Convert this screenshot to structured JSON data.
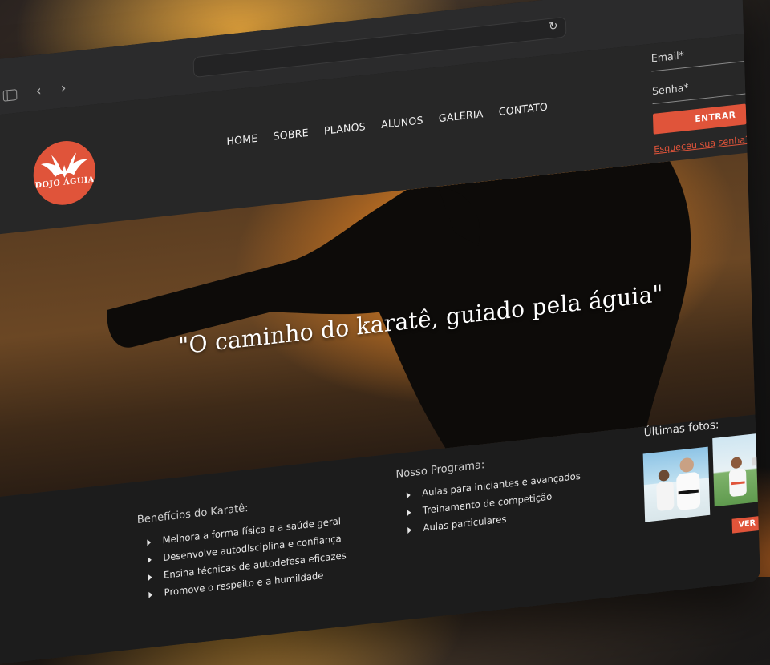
{
  "browser": {
    "url": "",
    "nav_back": "‹",
    "nav_fwd": "›",
    "reload": "↻"
  },
  "site": {
    "logo_text": "DOJO ÁGUIA",
    "brand_color": "#e0543a",
    "nav": [
      "HOME",
      "SOBRE",
      "PLANOS",
      "ALUNOS",
      "GALERIA",
      "CONTATO"
    ]
  },
  "login": {
    "email_label": "Email*",
    "password_label": "Senha*",
    "button_label": "ENTRAR",
    "forgot_label": "Esqueceu sua senha?"
  },
  "hero": {
    "quote": "\"O caminho do karatê, guiado pela águia\""
  },
  "benefits": {
    "title": "Benefícios do Karatê:",
    "items": [
      "Melhora a forma física e a saúde geral",
      "Desenvolve autodisciplina e confiança",
      "Ensina técnicas de autodefesa eficazes",
      "Promove o respeito e a humildade"
    ]
  },
  "program": {
    "title": "Nosso Programa:",
    "items": [
      "Aulas para iniciantes e avançados",
      "Treinamento de competição",
      "Aulas particulares"
    ]
  },
  "photos": {
    "title": "Últimas fotos:",
    "button_label": "VER"
  }
}
